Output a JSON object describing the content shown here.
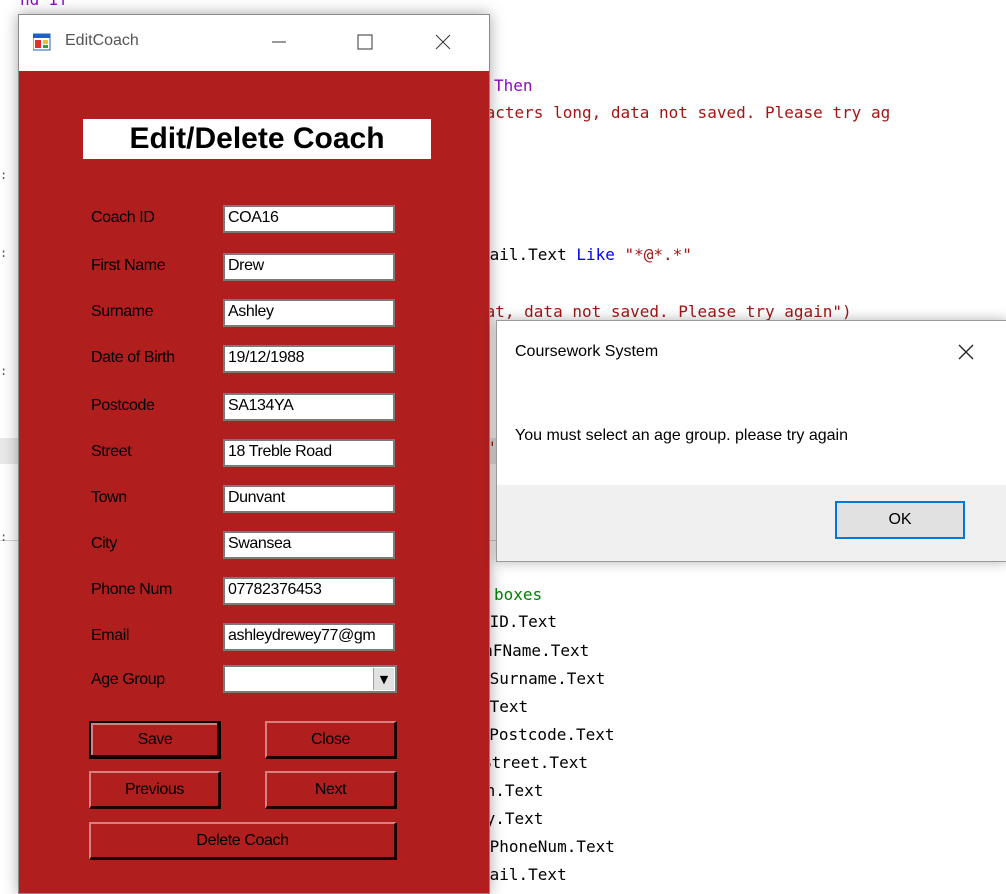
{
  "editor": {
    "lines": [
      {
        "key": "l0",
        "segments": [
          {
            "t": "nd If",
            "c": "purple"
          }
        ]
      },
      {
        "key": "l1",
        "segments": [
          {
            "t": "Then",
            "c": "purple"
          }
        ]
      },
      {
        "key": "l2",
        "segments": [
          {
            "t": "racters long, data not saved. Please try ag",
            "c": "str"
          }
        ]
      },
      {
        "key": "l3",
        "segments": [
          {
            "t": "mail.Text ",
            "c": "pl"
          },
          {
            "t": "Like ",
            "c": "kw"
          },
          {
            "t": "\"*@*.*\"",
            "c": "str"
          }
        ]
      },
      {
        "key": "l4",
        "segments": [
          {
            "t": "mat, data not saved. Please try again\")",
            "c": "str"
          }
        ]
      },
      {
        "key": "l5",
        "segments": [
          {
            "t": "\"",
            "c": "str"
          }
        ]
      },
      {
        "key": "l6",
        "segments": [
          {
            "t": "boxes",
            "c": "cm"
          }
        ]
      },
      {
        "key": "l7",
        "segments": [
          {
            "t": "hID.Text",
            "c": "pl"
          }
        ]
      },
      {
        "key": "l8",
        "segments": [
          {
            "t": "achFName.Text",
            "c": "pl"
          }
        ]
      },
      {
        "key": "l9",
        "segments": [
          {
            "t": "hSurname.Text",
            "c": "pl"
          }
        ]
      },
      {
        "key": "l10",
        "segments": [
          {
            "t": ".Text",
            "c": "pl"
          }
        ]
      },
      {
        "key": "l11",
        "segments": [
          {
            "t": "chPostcode.Text",
            "c": "pl"
          }
        ]
      },
      {
        "key": "l12",
        "segments": [
          {
            "t": "Street.Text",
            "c": "pl"
          }
        ]
      },
      {
        "key": "l13",
        "segments": [
          {
            "t": "wn.Text",
            "c": "pl"
          }
        ]
      },
      {
        "key": "l14",
        "segments": [
          {
            "t": "ty.Text",
            "c": "pl"
          }
        ]
      },
      {
        "key": "l15",
        "segments": [
          {
            "t": "hPhoneNum.Text",
            "c": "pl"
          }
        ]
      },
      {
        "key": "l16",
        "segments": [
          {
            "t": "mail.Text",
            "c": "pl"
          }
        ]
      }
    ]
  },
  "window": {
    "title": "EditCoach",
    "heading": "Edit/Delete Coach",
    "fields": [
      {
        "label": "Coach ID",
        "value": "COA16"
      },
      {
        "label": "First Name",
        "value": "Drew"
      },
      {
        "label": "Surname",
        "value": "Ashley"
      },
      {
        "label": "Date of Birth",
        "value": "19/12/1988"
      },
      {
        "label": "Postcode",
        "value": "SA134YA"
      },
      {
        "label": "Street",
        "value": "18 Treble Road"
      },
      {
        "label": "Town",
        "value": "Dunvant"
      },
      {
        "label": "City",
        "value": "Swansea"
      },
      {
        "label": "Phone Num",
        "value": "07782376453"
      },
      {
        "label": "Email",
        "value": "ashleydrewey77@gm"
      }
    ],
    "age_group": {
      "label": "Age Group",
      "value": ""
    },
    "buttons": {
      "save": "Save",
      "close": "Close",
      "previous": "Previous",
      "next": "Next",
      "delete": "Delete Coach"
    }
  },
  "message_box": {
    "title": "Coursework System",
    "text": "You must select an age group. please try again",
    "ok": "OK"
  },
  "colors": {
    "form_bg": "#b01e1e",
    "code_keyword": "#0000ff",
    "code_string": "#a31515",
    "code_comment": "#008000"
  }
}
